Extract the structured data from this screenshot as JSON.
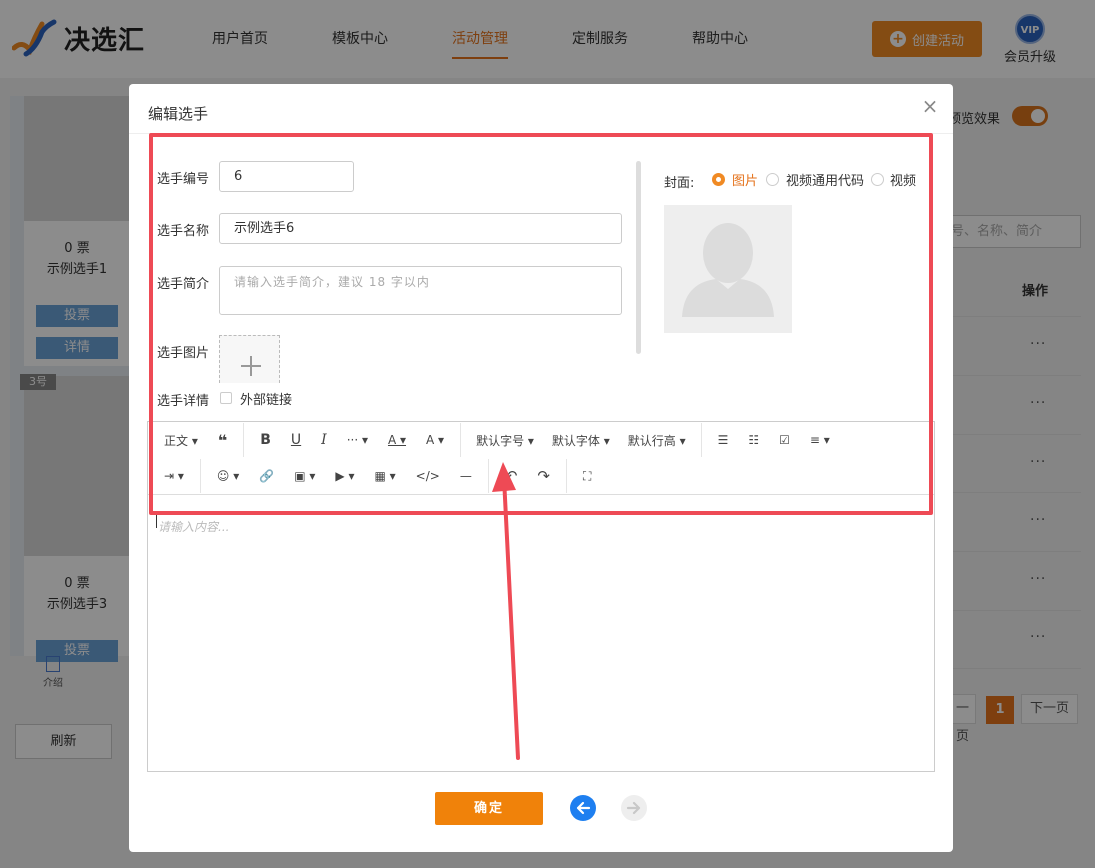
{
  "header": {
    "brand": "决选汇",
    "nav": [
      "用户首页",
      "模板中心",
      "活动管理",
      "定制服务",
      "帮助中心"
    ],
    "active_nav": "活动管理",
    "create_button": "创建活动",
    "vip_badge": "VIP",
    "vip_label": "会员升级"
  },
  "background": {
    "cards": [
      {
        "votes": "0 票",
        "name": "示例选手1",
        "vote_btn": "投票",
        "detail_btn": "详情"
      },
      {
        "votes": "0 票",
        "name": "示例选手3",
        "vote_btn": "投票"
      }
    ],
    "tag": "3号",
    "intro_label": "介绍",
    "refresh": "刷新",
    "preview_label": "预览效果",
    "search_placeholder": "号、名称、简介",
    "op_header": "操作",
    "row_action": "···",
    "pagination": {
      "prev": "一页",
      "current": "1",
      "next": "下一页"
    },
    "colors": {
      "accent": "#e5731c",
      "button_blue": "#6aa2d8"
    }
  },
  "modal": {
    "title": "编辑选手",
    "close": "×",
    "fields": {
      "number_label": "选手编号",
      "number_value": "6",
      "name_label": "选手名称",
      "name_value": "示例选手6",
      "intro_label": "选手简介",
      "intro_placeholder": "请输入选手简介，建议 18 字以内",
      "image_label": "选手图片",
      "detail_label": "选手详情",
      "external_link_label": "外部链接"
    },
    "cover": {
      "label": "封面:",
      "options": [
        "图片",
        "视频通用代码",
        "视频"
      ],
      "selected": "图片"
    },
    "editor": {
      "toolbar_row1": [
        "正文 ▾",
        "❝",
        "B",
        "U",
        "I",
        "··· ▾",
        "A ▾",
        "A ▾",
        "默认字号 ▾",
        "默认字体 ▾",
        "默认行高 ▾",
        "☰",
        "☷",
        "☑",
        "≡ ▾"
      ],
      "toolbar_row2": [
        "⇥ ▾",
        "☺ ▾",
        "🔗",
        "▣ ▾",
        "▶ ▾",
        "▦ ▾",
        "</>",
        "—",
        "↶",
        "↷",
        "⛶"
      ],
      "placeholder": "请输入内容..."
    },
    "confirm": "确定"
  },
  "annotation_color": "#ee4a55"
}
